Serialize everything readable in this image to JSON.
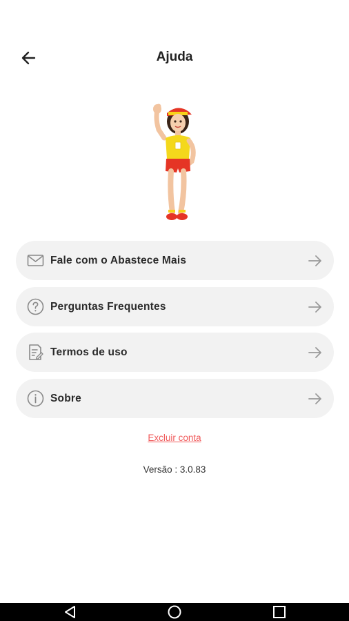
{
  "header": {
    "title": "Ajuda",
    "back_icon": "arrow-left-icon"
  },
  "mascot": {
    "icon": "mascot-illustration"
  },
  "menu": {
    "items": [
      {
        "label": "Fale com o Abastece Mais",
        "icon": "mail-icon"
      },
      {
        "label": "Perguntas Frequentes",
        "icon": "help-circle-icon"
      },
      {
        "label": "Termos de uso",
        "icon": "document-icon"
      },
      {
        "label": "Sobre",
        "icon": "info-icon"
      }
    ],
    "arrow_icon": "arrow-right-icon"
  },
  "delete_account": {
    "label": "Excluir conta",
    "color": "#f0595a"
  },
  "version": {
    "text": "Versão : 3.0.83"
  },
  "navbar": {
    "items": [
      "back-triangle-icon",
      "home-circle-icon",
      "recents-square-icon"
    ]
  }
}
